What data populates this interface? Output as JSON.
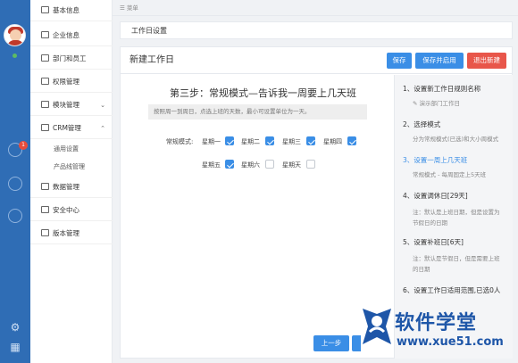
{
  "topbar": {
    "menu_label": "菜单"
  },
  "nav": {
    "items": [
      {
        "label": "基本信息"
      },
      {
        "label": "企业信息"
      },
      {
        "label": "部门和员工"
      },
      {
        "label": "权限管理"
      },
      {
        "label": "模块管理"
      },
      {
        "label": "CRM管理"
      },
      {
        "label": "数据管理"
      },
      {
        "label": "安全中心"
      },
      {
        "label": "版本管理"
      }
    ],
    "crm_sub": [
      {
        "label": "通用设置"
      },
      {
        "label": "产品线管理"
      }
    ]
  },
  "rail": {
    "notification_count": "1"
  },
  "breadcrumb": {
    "label": "工作日设置"
  },
  "panel": {
    "title": "新建工作日",
    "save_label": "保存",
    "save_enable_label": "保存并启用",
    "exit_label": "退出新建"
  },
  "step": {
    "title": "第三步：常规模式—告诉我一周要上几天班",
    "hint": "按照周一到周日，点选上班的天数，最小可设置单位为一天。",
    "mode_label": "常规模式:",
    "days": [
      {
        "label": "星期一",
        "checked": true
      },
      {
        "label": "星期二",
        "checked": true
      },
      {
        "label": "星期三",
        "checked": true
      },
      {
        "label": "星期四",
        "checked": true
      },
      {
        "label": "星期五",
        "checked": true
      },
      {
        "label": "星期六",
        "checked": false
      },
      {
        "label": "星期天",
        "checked": false
      }
    ],
    "prev_label": "上一步"
  },
  "steps": [
    {
      "title": "1、设置新工作日规则名称",
      "desc": "✎ 演示部门工作日"
    },
    {
      "title": "2、选择模式",
      "desc": "分为常规模式(已选)和大小周模式"
    },
    {
      "title": "3、设置一周上几天班",
      "desc": "常规模式 - 每周固定上5天班"
    },
    {
      "title": "4、设置调休日[29天]",
      "desc": "注：默认是上班日期，但是设置为",
      "desc2": "节假日的日期"
    },
    {
      "title": "5、设置补班日[6天]",
      "desc": "注：默认是节假日，但是需要上班",
      "desc2": "的日期"
    },
    {
      "title": "6、设置工作日适用范围,已选0人"
    }
  ],
  "watermark": {
    "brand": "软件学堂",
    "url": "www.xue51.com"
  },
  "colors": {
    "accent": "#3a8ee6",
    "danger": "#e8564a",
    "rail": "#2f6db5"
  }
}
